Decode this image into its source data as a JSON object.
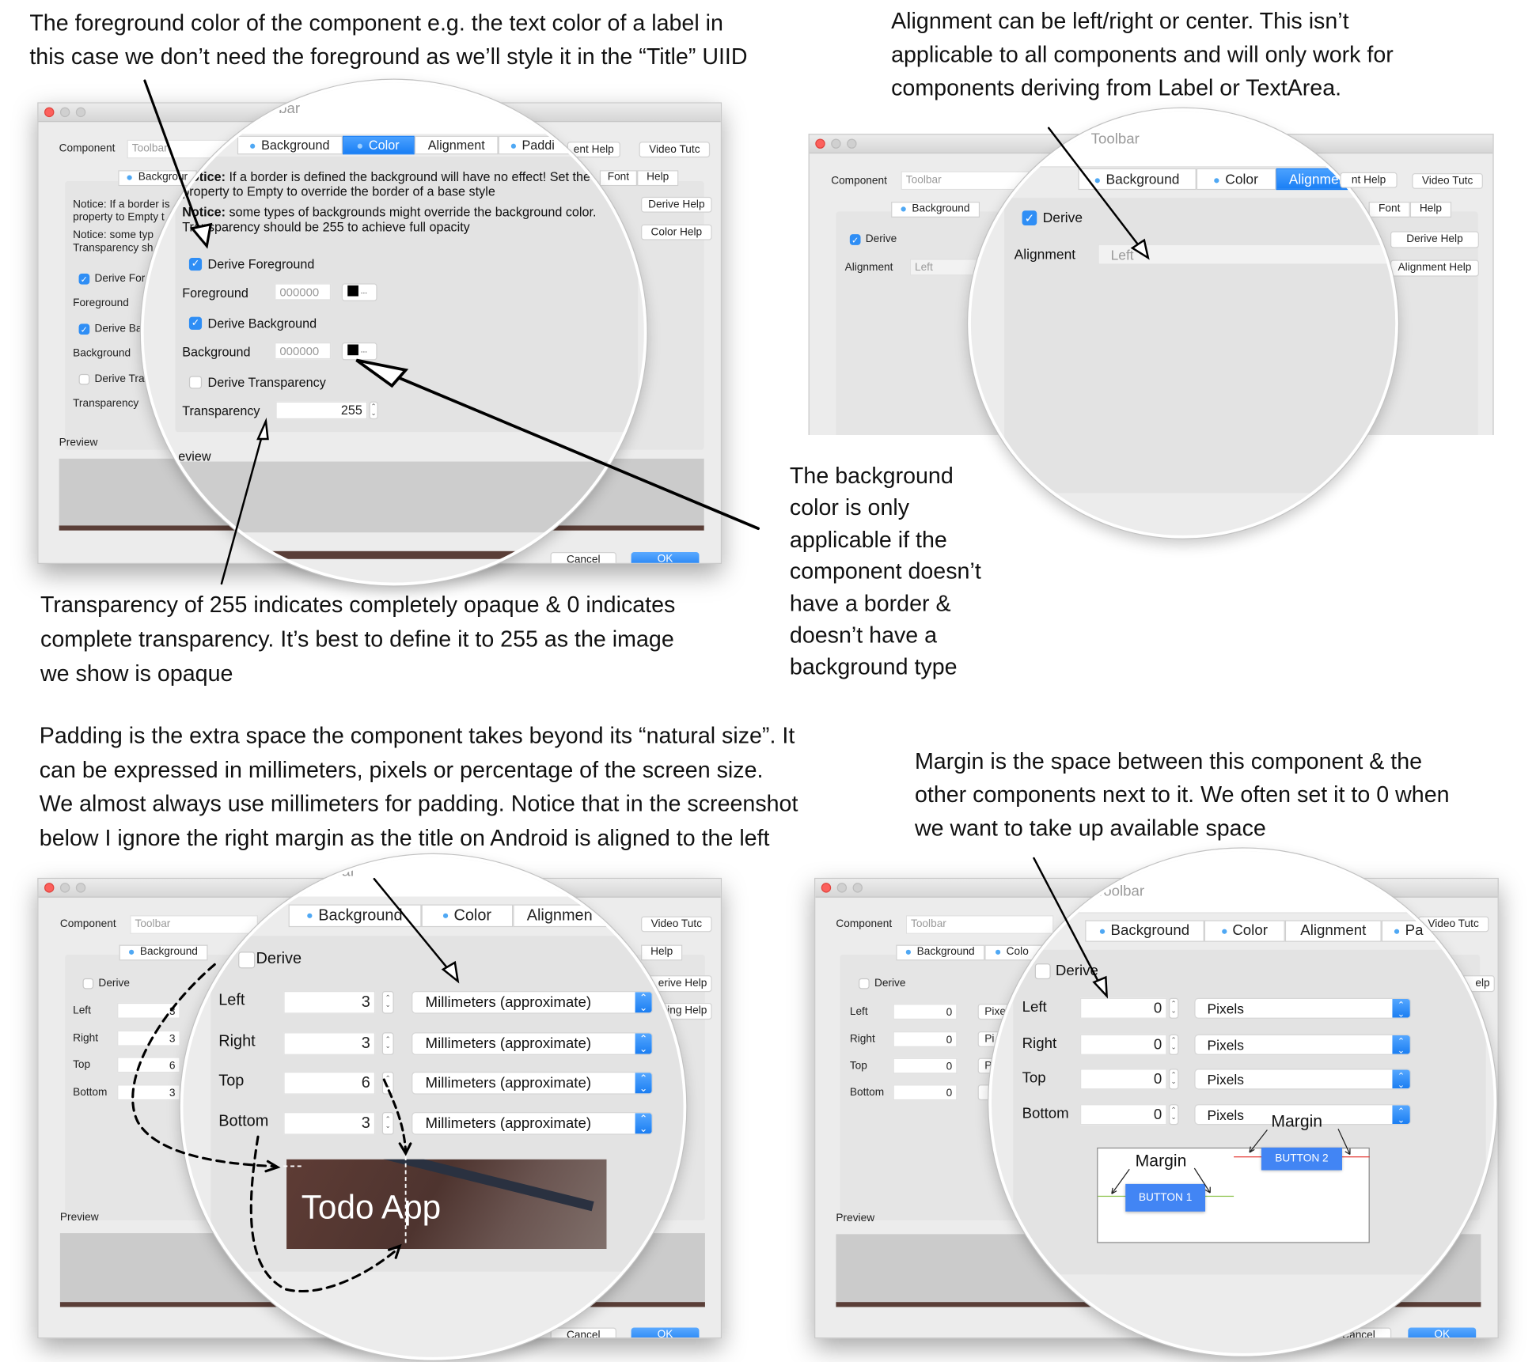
{
  "annotations": {
    "foreground": [
      "The foreground color of the component e.g. the text color of a label in",
      "this case we don’t need the foreground as we’ll style it in the “Title” UIID"
    ],
    "alignment": [
      "Alignment can be left/right or center. This isn’t",
      "applicable to all components and will only work for",
      "components deriving from Label or TextArea."
    ],
    "background": [
      "The background",
      "color is only",
      "applicable if the",
      "component doesn’t",
      "have a border &",
      "doesn’t have a",
      "background type"
    ],
    "transparency": [
      "Transparency of 255 indicates completely opaque & 0 indicates",
      "complete transparency. It’s best to define it to 255 as the image",
      "we show is opaque"
    ],
    "padding": [
      "Padding is the extra space the component takes beyond its “natural size”. It",
      "can be expressed in millimeters, pixels or percentage of the screen size.",
      "We almost always use millimeters for padding. Notice that in the screenshot",
      "below I ignore the right margin as the title on Android is aligned to the left"
    ],
    "margin": [
      "Margin is the space between this component & the",
      "other components next to it. We often set it to 0 when",
      "we want to take up available space"
    ]
  },
  "common": {
    "component_label": "Component",
    "component_value": "Toolbar",
    "video_button": "Video Tutc",
    "font_tab": "Font",
    "help_tab": "Help",
    "preview_label": "Preview",
    "cancel": "Cancel",
    "ok": "OK",
    "accent_color": "#1a7ff5"
  },
  "color_panel": {
    "window": {
      "element_help": "ent Help",
      "background_tab": "Backgrour",
      "notice1": [
        "Notice: If a border is",
        "property to Empty t"
      ],
      "notice2": [
        "Notice: some typ",
        "Transparency sh"
      ],
      "derive_fg": "Derive For",
      "fg_label": "Foreground",
      "derive_bg": "Derive Ba",
      "bg_label": "Background",
      "derive_tr": "Derive Tra",
      "tr_label": "Transparency",
      "derive_help": "Derive Help",
      "color_help": "Color Help"
    },
    "loupe": {
      "title_partial": "bar",
      "tabs": [
        "Background",
        "Color",
        "Alignment",
        "Paddi"
      ],
      "selected_tab": "Color",
      "notice_bold": "Notice:",
      "notice1": [
        " If a border is defined the background will have no effect! Set the",
        "property to Empty to override the border of a base style"
      ],
      "notice2": [
        " some types of backgrounds might override the background color.",
        "Transparency should be 255 to achieve full opacity"
      ],
      "derive_fg": "Derive Foreground",
      "derive_fg_checked": true,
      "fg_label": "Foreground",
      "fg_value": "000000",
      "derive_bg": "Derive Background",
      "derive_bg_checked": true,
      "bg_label": "Background",
      "bg_value": "000000",
      "derive_tr": "Derive Transparency",
      "derive_tr_checked": false,
      "tr_label": "Transparency",
      "tr_value": "255",
      "swatch_more": "...",
      "preview_partial": "eview"
    }
  },
  "alignment_panel": {
    "window": {
      "element_help": "nt Help",
      "background_tab": "Background",
      "derive": "Derive",
      "alignment_label": "Alignment",
      "alignment_value": "Left",
      "derive_help": "Derive Help",
      "alignment_help": "Alignment Help"
    },
    "loupe": {
      "title": "Toolbar",
      "tabs": [
        "Background",
        "Color",
        "Alignment"
      ],
      "selected_tab": "Alignment",
      "derive": "Derive",
      "derive_checked": true,
      "alignment_label": "Alignment",
      "alignment_value": "Left"
    }
  },
  "padding_panel": {
    "window": {
      "background_tab": "Background",
      "derive": "Derive",
      "rows": [
        {
          "label": "Left",
          "value": "3"
        },
        {
          "label": "Right",
          "value": "3"
        },
        {
          "label": "Top",
          "value": "6"
        },
        {
          "label": "Bottom",
          "value": "3"
        }
      ],
      "derive_help": "erive Help",
      "padding_help": "ing Help"
    },
    "loupe": {
      "title_partial": "bar",
      "tabs": [
        "Background",
        "Color",
        "Alignmen"
      ],
      "derive": "Derive",
      "derive_checked": false,
      "rows": [
        {
          "label": "Left",
          "value": "3",
          "unit": "Millimeters (approximate)"
        },
        {
          "label": "Right",
          "value": "3",
          "unit": "Millimeters (approximate)"
        },
        {
          "label": "Top",
          "value": "6",
          "unit": "Millimeters (approximate)"
        },
        {
          "label": "Bottom",
          "value": "3",
          "unit": "Millimeters (approximate)"
        }
      ],
      "preview_title": "Todo App"
    }
  },
  "margin_panel": {
    "window": {
      "background_tab": "Background",
      "color_tab": "Colo",
      "derive": "Derive",
      "rows": [
        {
          "label": "Left",
          "value": "0",
          "unit": "Pixe"
        },
        {
          "label": "Right",
          "value": "0",
          "unit": "Pi"
        },
        {
          "label": "Top",
          "value": "0",
          "unit": "P"
        },
        {
          "label": "Bottom",
          "value": "0",
          "unit": ""
        }
      ],
      "help_partial": "elp"
    },
    "loupe": {
      "title": "Toolbar",
      "tabs": [
        "Background",
        "Color",
        "Alignment",
        "Pa"
      ],
      "derive": "Derive",
      "derive_checked": false,
      "rows": [
        {
          "label": "Left",
          "value": "0",
          "unit": "Pixels"
        },
        {
          "label": "Right",
          "value": "0",
          "unit": "Pixels"
        },
        {
          "label": "Top",
          "value": "0",
          "unit": "Pixels"
        },
        {
          "label": "Bottom",
          "value": "0",
          "unit": "Pixels"
        }
      ],
      "diagram": {
        "margin_label": "Margin",
        "button1": "BUTTON 1",
        "button2": "BUTTON 2",
        "button_color": "#4285f4"
      }
    }
  }
}
